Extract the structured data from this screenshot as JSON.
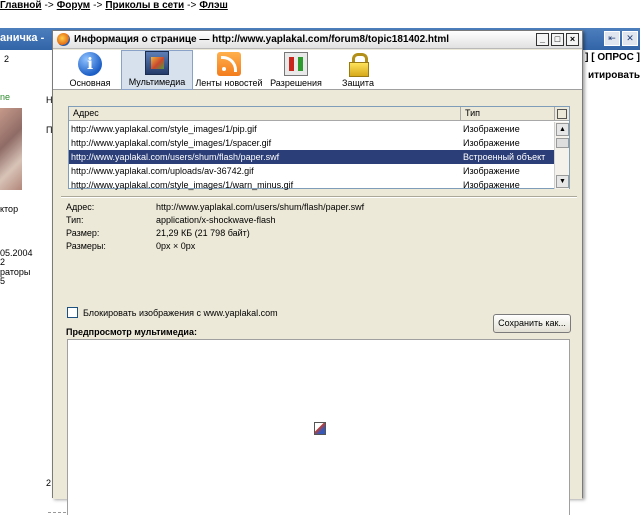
{
  "background": {
    "breadcrumb": [
      "Главной",
      "Форум",
      "Приколы в сети",
      "Флэш"
    ],
    "breadcrumb_sep": "->",
    "titlebar_left": "аничка -",
    "right_opros": "] [ ОПРОС ]",
    "right_cit": "итировать",
    "left_items": [
      "2",
      "ne",
      "Н",
      "П",
      "ктор",
      "05.2004",
      "2",
      "раторы",
      "5",
      "2"
    ]
  },
  "dialog": {
    "title": "Информация о странице — http://www.yaplakal.com/forum8/topic181402.html",
    "win_buttons": [
      "_",
      "□",
      "×"
    ],
    "toolbar": [
      {
        "label": "Основная",
        "icon": "info-icon"
      },
      {
        "label": "Мультимедиа",
        "icon": "media-icon",
        "selected": true
      },
      {
        "label": "Ленты новостей",
        "icon": "rss-icon"
      },
      {
        "label": "Разрешения",
        "icon": "permissions-icon"
      },
      {
        "label": "Защита",
        "icon": "lock-icon"
      }
    ],
    "table": {
      "headers": {
        "address": "Адрес",
        "type": "Тип"
      },
      "rows": [
        {
          "address": "http://www.yaplakal.com/style_images/1/pip.gif",
          "type": "Изображение"
        },
        {
          "address": "http://www.yaplakal.com/style_images/1/spacer.gif",
          "type": "Изображение"
        },
        {
          "address": "http://www.yaplakal.com/users/shum/flash/paper.swf",
          "type": "Встроенный объект"
        },
        {
          "address": "http://www.yaplakal.com/uploads/av-36742.gif",
          "type": "Изображение"
        },
        {
          "address": "http://www.yaplakal.com/style_images/1/warn_minus.gif",
          "type": "Изображение"
        }
      ]
    },
    "details": {
      "address_label": "Адрес:",
      "address_value": "http://www.yaplakal.com/users/shum/flash/paper.swf",
      "type_label": "Тип:",
      "type_value": "application/x-shockwave-flash",
      "size_label": "Размер:",
      "size_value": "21,29 КБ (21 798 байт)",
      "dims_label": "Размеры:",
      "dims_value": "0px × 0px"
    },
    "block_images_label": "Блокировать изображения с www.yaplakal.com",
    "save_button": "Сохранить как...",
    "preview_label": "Предпросмотр мультимедиа:"
  }
}
